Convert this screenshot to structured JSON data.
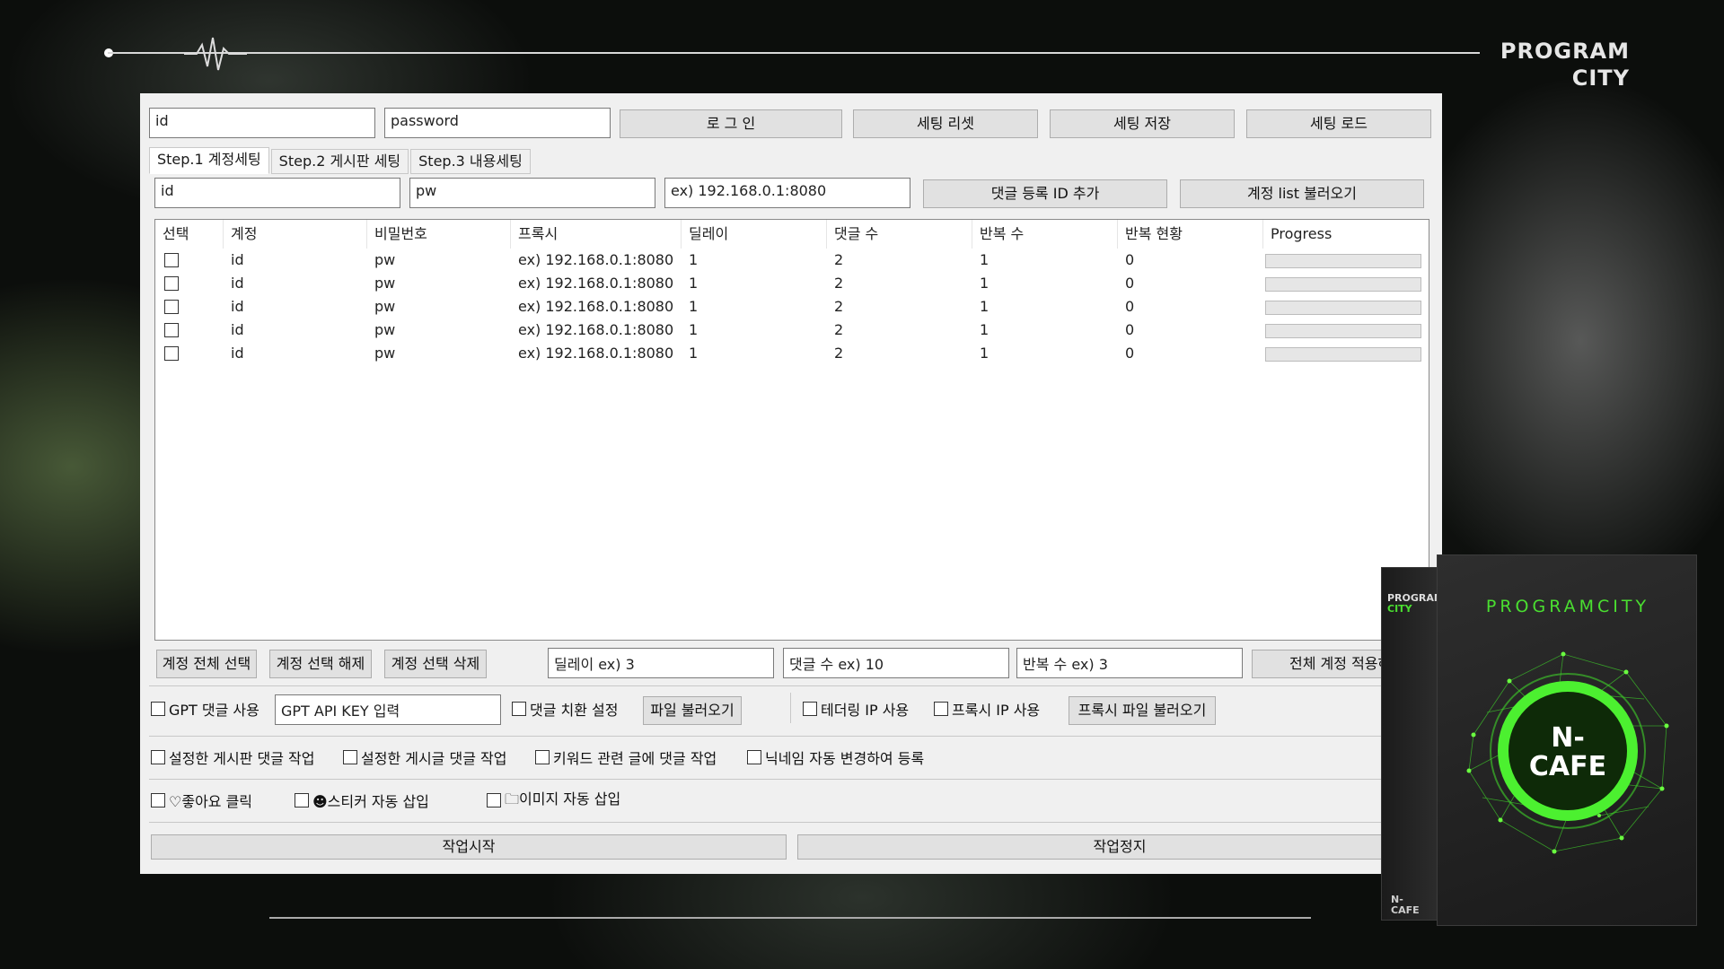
{
  "brand": {
    "line1": "PROGRAM",
    "line2": "CITY"
  },
  "login": {
    "id_value": "id",
    "password_value": "password",
    "login_label": "로 그 인",
    "reset_label": "세팅 리셋",
    "save_label": "세팅 저장",
    "load_label": "세팅 로드"
  },
  "tabs": [
    {
      "label": "Step.1 계정세팅"
    },
    {
      "label": "Step.2 게시판 세팅"
    },
    {
      "label": "Step.3 내용세팅"
    }
  ],
  "account_form": {
    "id_value": "id",
    "pw_value": "pw",
    "proxy_value": "ex) 192.168.0.1:8080",
    "add_label": "댓글 등록 ID 추가",
    "load_list_label": "계정 list 불러오기"
  },
  "table": {
    "headers": [
      "선택",
      "계정",
      "비밀번호",
      "프록시",
      "딜레이",
      "댓글 수",
      "반복 수",
      "반복 현황",
      "Progress"
    ],
    "rows": [
      {
        "account": "id",
        "password": "pw",
        "proxy": "ex) 192.168.0.1:8080",
        "delay": "1",
        "comments": "2",
        "repeat": "1",
        "status": "0",
        "progress": 0
      },
      {
        "account": "id",
        "password": "pw",
        "proxy": "ex) 192.168.0.1:8080",
        "delay": "1",
        "comments": "2",
        "repeat": "1",
        "status": "0",
        "progress": 0
      },
      {
        "account": "id",
        "password": "pw",
        "proxy": "ex) 192.168.0.1:8080",
        "delay": "1",
        "comments": "2",
        "repeat": "1",
        "status": "0",
        "progress": 0
      },
      {
        "account": "id",
        "password": "pw",
        "proxy": "ex) 192.168.0.1:8080",
        "delay": "1",
        "comments": "2",
        "repeat": "1",
        "status": "0",
        "progress": 0
      },
      {
        "account": "id",
        "password": "pw",
        "proxy": "ex) 192.168.0.1:8080",
        "delay": "1",
        "comments": "2",
        "repeat": "1",
        "status": "0",
        "progress": 0
      }
    ]
  },
  "bulk": {
    "select_all_label": "계정 전체 선택",
    "deselect_label": "계정 선택 해제",
    "delete_label": "계정 선택 삭제",
    "delay_value": "딜레이 ex) 3",
    "comments_value": "댓글 수 ex) 10",
    "repeat_value": "반복 수 ex) 3",
    "apply_all_label": "전체 계정 적용하기"
  },
  "options": {
    "gpt_label": "GPT 댓글 사용",
    "gpt_key_value": "GPT API KEY 입력",
    "replace_label": "댓글 치환 설정",
    "file_load_label": "파일 불러오기",
    "tethering_label": "테더링 IP 사용",
    "proxy_ip_label": "프록시 IP 사용",
    "proxy_file_label": "프록시 파일 불러오기",
    "board_comment_label": "설정한 게시판 댓글 작업",
    "post_comment_label": "설정한 게시글 댓글 작업",
    "keyword_comment_label": "키워드 관련 글에 댓글 작업",
    "nickname_label": "닉네임 자동 변경하여 등록",
    "like_label": "♡좋아요 클릭",
    "sticker_label": "☻스티커 자동 삽입",
    "image_label": "🗀이미지 자동 삽입"
  },
  "actions": {
    "start_label": "작업시작",
    "stop_label": "작업정지"
  },
  "product_box": {
    "side_line1": "PROGRAM",
    "side_line2": "CITY",
    "title": "PROGRAMCITY",
    "logo_line1": "N-",
    "logo_line2": "CAFE",
    "side_bottom_line1": "N-",
    "side_bottom_line2": "CAFE"
  },
  "colors": {
    "accent_green": "#4adf30",
    "progress_fill": "#06b025"
  }
}
